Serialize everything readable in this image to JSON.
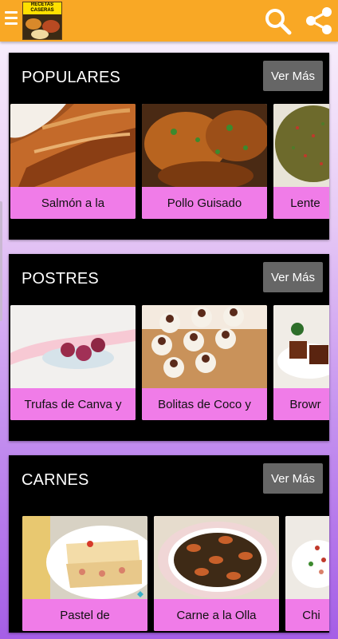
{
  "app": {
    "logo_text": "RECETAS CASERAS"
  },
  "sections": [
    {
      "title": "POPULARES",
      "more_label": "Ver Más",
      "cards": [
        {
          "label": "Salmón a la"
        },
        {
          "label": "Pollo Guisado"
        },
        {
          "label": "Lente"
        }
      ]
    },
    {
      "title": "POSTRES",
      "more_label": "Ver Más",
      "cards": [
        {
          "label": "Trufas de Canva y"
        },
        {
          "label": "Bolitas de Coco y"
        },
        {
          "label": "Browr"
        }
      ]
    },
    {
      "title": "CARNES",
      "more_label": "Ver Más",
      "cards": [
        {
          "label": "Pastel de"
        },
        {
          "label": "Carne a la Olla"
        },
        {
          "label": "Chi"
        }
      ]
    }
  ],
  "colors": {
    "appbar": "#f9a825",
    "section_bg": "#000000",
    "card_label_bg": "#f07ce8",
    "more_button_bg": "#666666"
  },
  "icons": [
    "menu-icon",
    "search-icon",
    "share-icon"
  ]
}
